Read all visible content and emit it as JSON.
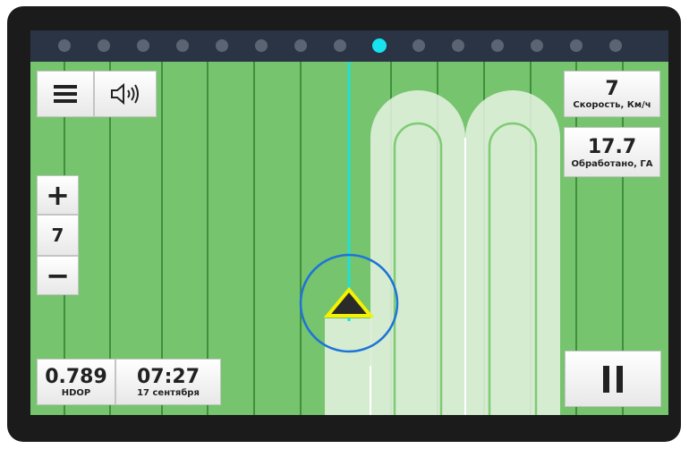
{
  "status": {
    "dots_count": 15,
    "active_index": 8
  },
  "controls": {
    "menu_icon": "hamburger-icon",
    "sound_icon": "speaker-icon",
    "zoom_in_label": "+",
    "zoom_level": "7",
    "zoom_out_label": "−",
    "pause_icon": "pause-icon"
  },
  "stats": {
    "speed_value": "7",
    "speed_label": "Скорость, Км/ч",
    "area_value": "17.7",
    "area_label": "Обработано, ГА"
  },
  "gps": {
    "hdop_value": "0.789",
    "hdop_label": "HDOP",
    "time_value": "07:27",
    "date_label": "17 сентября"
  },
  "colors": {
    "field": "#76c46e",
    "guideline": "#1fe0d6",
    "vehicle_fill": "#2a2a2a",
    "vehicle_outline": "#f4f200",
    "circle": "#1e73d8",
    "active_dot": "#17e2f0"
  }
}
